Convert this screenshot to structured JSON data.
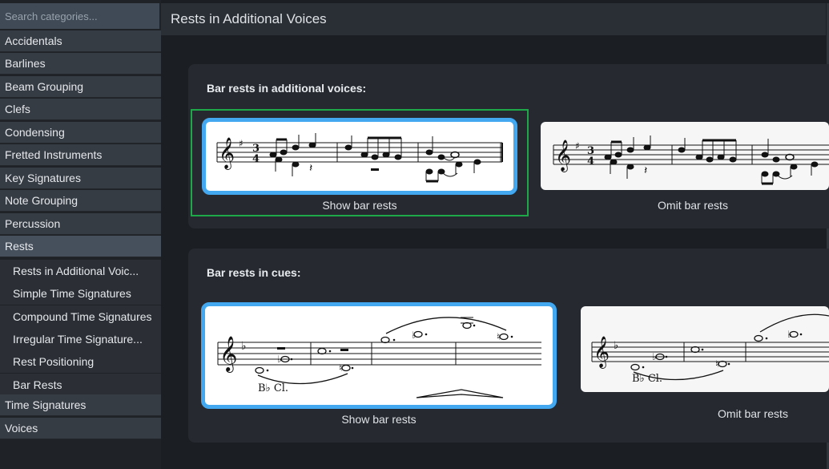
{
  "sidebar": {
    "search_placeholder": "Search categories...",
    "categories": [
      {
        "label": "Accidentals"
      },
      {
        "label": "Barlines"
      },
      {
        "label": "Beam Grouping"
      },
      {
        "label": "Clefs"
      },
      {
        "label": "Condensing"
      },
      {
        "label": "Fretted Instruments"
      },
      {
        "label": "Key Signatures"
      },
      {
        "label": "Note Grouping"
      },
      {
        "label": "Percussion"
      },
      {
        "label": "Rests"
      }
    ],
    "rests_subitems": [
      {
        "label": "Rests in Additional Voic..."
      },
      {
        "label": "Simple Time Signatures"
      },
      {
        "label": "Compound Time Signatures"
      },
      {
        "label": "Irregular Time Signature..."
      },
      {
        "label": "Rest Positioning"
      },
      {
        "label": "Bar Rests"
      }
    ],
    "after": [
      {
        "label": "Time Signatures"
      },
      {
        "label": "Voices"
      }
    ]
  },
  "main": {
    "title": "Rests in Additional Voices",
    "sections": [
      {
        "title": "Bar rests in additional voices:",
        "options": [
          {
            "caption": "Show bar rests",
            "selected": true
          },
          {
            "caption": "Omit bar rests",
            "selected": false
          }
        ]
      },
      {
        "title": "Bar rests in cues:",
        "options": [
          {
            "caption": "Show bar rests",
            "selected": true,
            "instrument": "B♭ Cl."
          },
          {
            "caption": "Omit bar rests",
            "selected": false,
            "instrument": "B♭ Cl."
          }
        ]
      }
    ]
  },
  "colors": {
    "accent_selected_border": "#43a8ef",
    "focus_ring": "#1fa84a"
  }
}
